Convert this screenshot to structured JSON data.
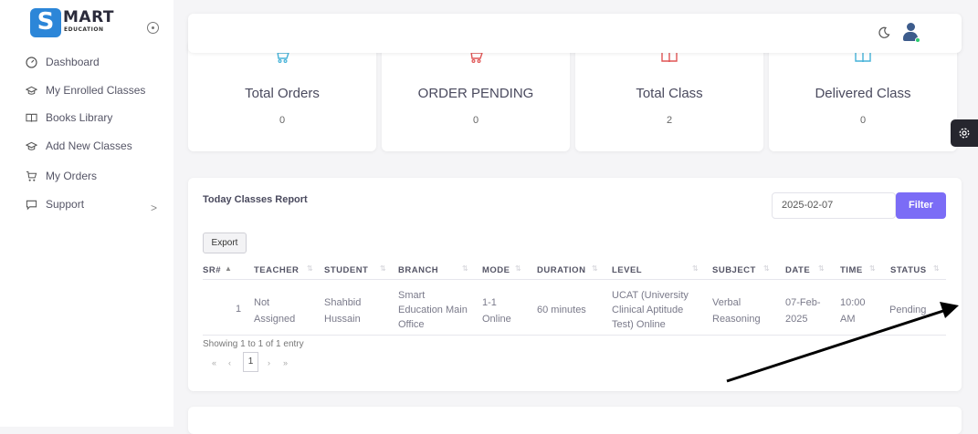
{
  "brand": {
    "logo_letter": "S",
    "name": "MART",
    "tagline": "EDUCATION"
  },
  "sidebar": {
    "items": [
      {
        "label": "Dashboard",
        "icon": "dashboard-icon"
      },
      {
        "label": "My Enrolled Classes",
        "icon": "graduation-cap-icon"
      },
      {
        "label": "Books Library",
        "icon": "book-icon"
      },
      {
        "label": "Add New Classes",
        "icon": "graduation-cap-icon"
      },
      {
        "label": "My Orders",
        "icon": "cart-icon"
      },
      {
        "label": "Support",
        "icon": "chat-icon"
      }
    ],
    "support_chevron": ">"
  },
  "stats": [
    {
      "title": "Total Orders",
      "value": "0",
      "icon": "cart-icon",
      "color": "#45b2d8"
    },
    {
      "title": "ORDER PENDING",
      "value": "0",
      "icon": "cart-icon",
      "color": "#e05555"
    },
    {
      "title": "Total Class",
      "value": "2",
      "icon": "book-icon",
      "color": "#e05555"
    },
    {
      "title": "Delivered Class",
      "value": "0",
      "icon": "book-icon",
      "color": "#45b2d8"
    }
  ],
  "report": {
    "title": "Today Classes Report",
    "date_value": "2025-02-07",
    "filter_label": "Filter",
    "export_label": "Export",
    "columns": [
      "SR#",
      "TEACHER",
      "STUDENT",
      "BRANCH",
      "MODE",
      "DURATION",
      "LEVEL",
      "SUBJECT",
      "DATE",
      "TIME",
      "STATUS"
    ],
    "rows": [
      {
        "sr": "1",
        "teacher": [
          "Not",
          "Assigned"
        ],
        "student": [
          "Shahbid",
          "Hussain"
        ],
        "branch": [
          "Smart",
          "Education Main",
          "Office"
        ],
        "mode": [
          "1-1",
          "Online"
        ],
        "duration": "60 minutes",
        "level": [
          "UCAT (University",
          "Clinical Aptitude",
          "Test) Online"
        ],
        "subject": [
          "Verbal",
          "Reasoning"
        ],
        "date": [
          "07-Feb-",
          "2025"
        ],
        "time": [
          "10:00",
          "AM"
        ],
        "status": "Pending"
      }
    ],
    "showing": "Showing 1 to 1 of 1 entry",
    "pager": {
      "first": "«",
      "prev": "‹",
      "current": "1",
      "next": "›",
      "last": "»"
    }
  },
  "colors": {
    "accent": "#7b6cf6",
    "brand_blue": "#2c86d8"
  }
}
